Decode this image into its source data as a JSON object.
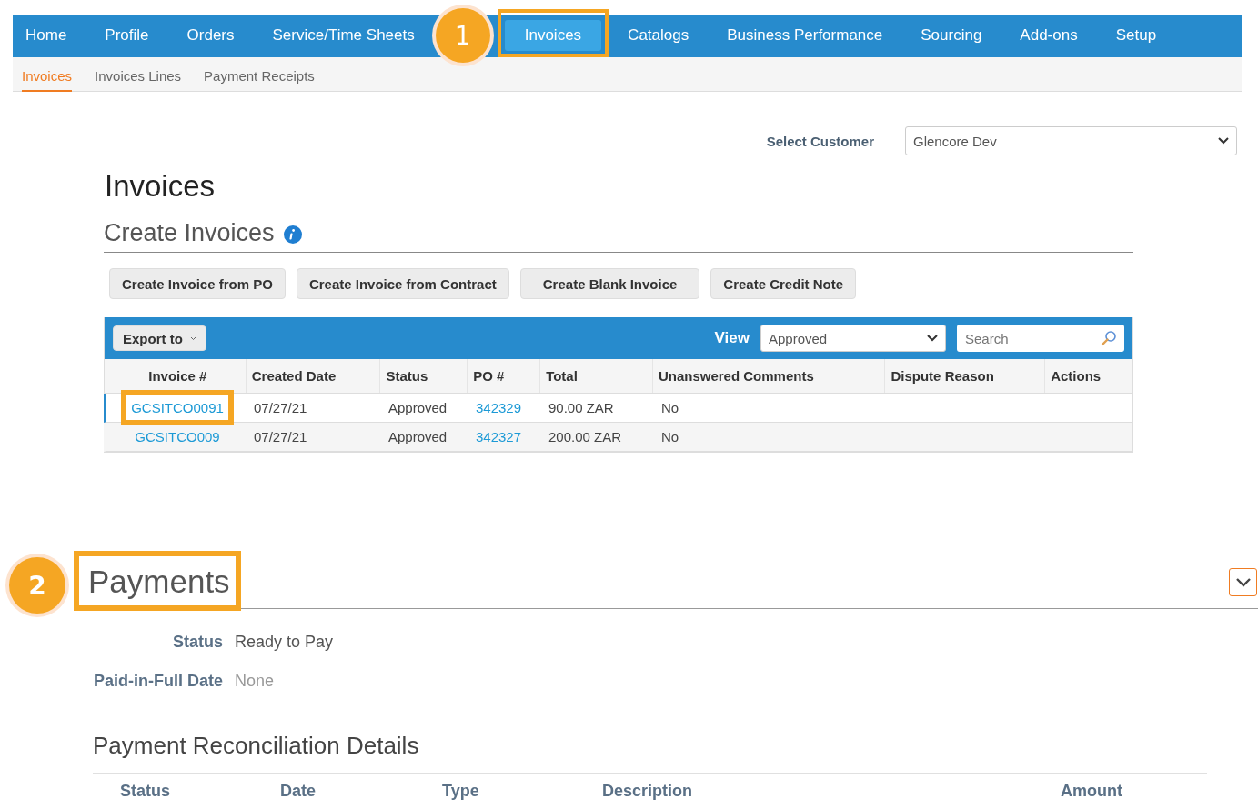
{
  "top_nav": [
    {
      "label": "Home",
      "selected": false,
      "highlighted": false
    },
    {
      "label": "Profile",
      "selected": false,
      "highlighted": false
    },
    {
      "label": "Orders",
      "selected": false,
      "highlighted": false
    },
    {
      "label": "Service/Time Sheets",
      "selected": false,
      "highlighted": false
    },
    {
      "label": "Invoices",
      "selected": true,
      "highlighted": true,
      "callout": "1"
    },
    {
      "label": "Catalogs",
      "selected": false,
      "highlighted": false
    },
    {
      "label": "Business Performance",
      "selected": false,
      "highlighted": false
    },
    {
      "label": "Sourcing",
      "selected": false,
      "highlighted": false
    },
    {
      "label": "Add-ons",
      "selected": false,
      "highlighted": false
    },
    {
      "label": "Setup",
      "selected": false,
      "highlighted": false
    }
  ],
  "sub_nav": [
    {
      "label": "Invoices",
      "selected": true
    },
    {
      "label": "Invoices Lines",
      "selected": false
    },
    {
      "label": "Payment Receipts",
      "selected": false
    }
  ],
  "customer": {
    "label": "Select Customer",
    "value": "Glencore Dev"
  },
  "page_title": "Invoices",
  "create_section": {
    "title": "Create Invoices",
    "buttons": [
      "Create Invoice from PO",
      "Create Invoice from Contract",
      "Create Blank Invoice",
      "Create Credit Note"
    ]
  },
  "table": {
    "export_button": "Export to",
    "view_label": "View",
    "view_value": "Approved",
    "search_placeholder": "Search",
    "columns": [
      "Invoice #",
      "Created Date",
      "Status",
      "PO #",
      "Total",
      "Unanswered Comments",
      "Dispute Reason",
      "Actions"
    ],
    "rows": [
      {
        "selected": true,
        "invoice_highlighted": true,
        "invoice": "GCSITCO0091",
        "created_date": "07/27/21",
        "status": "Approved",
        "po": "342329",
        "total": "90.00 ZAR",
        "unanswered_comments": "No"
      },
      {
        "selected": false,
        "invoice_highlighted": false,
        "invoice": "GCSITCO009",
        "created_date": "07/27/21",
        "status": "Approved",
        "po": "342327",
        "total": "200.00 ZAR",
        "unanswered_comments": "No"
      }
    ]
  },
  "payments": {
    "title": "Payments",
    "callout": "2",
    "highlighted": true,
    "fields": [
      {
        "label": "Status",
        "value": "Ready to Pay",
        "muted": false
      },
      {
        "label": "Paid-in-Full Date",
        "value": "None",
        "muted": true
      }
    ],
    "reconciliation": {
      "title": "Payment Reconciliation Details",
      "columns": [
        "Status",
        "Date",
        "Type",
        "Description",
        "Amount"
      ]
    }
  }
}
